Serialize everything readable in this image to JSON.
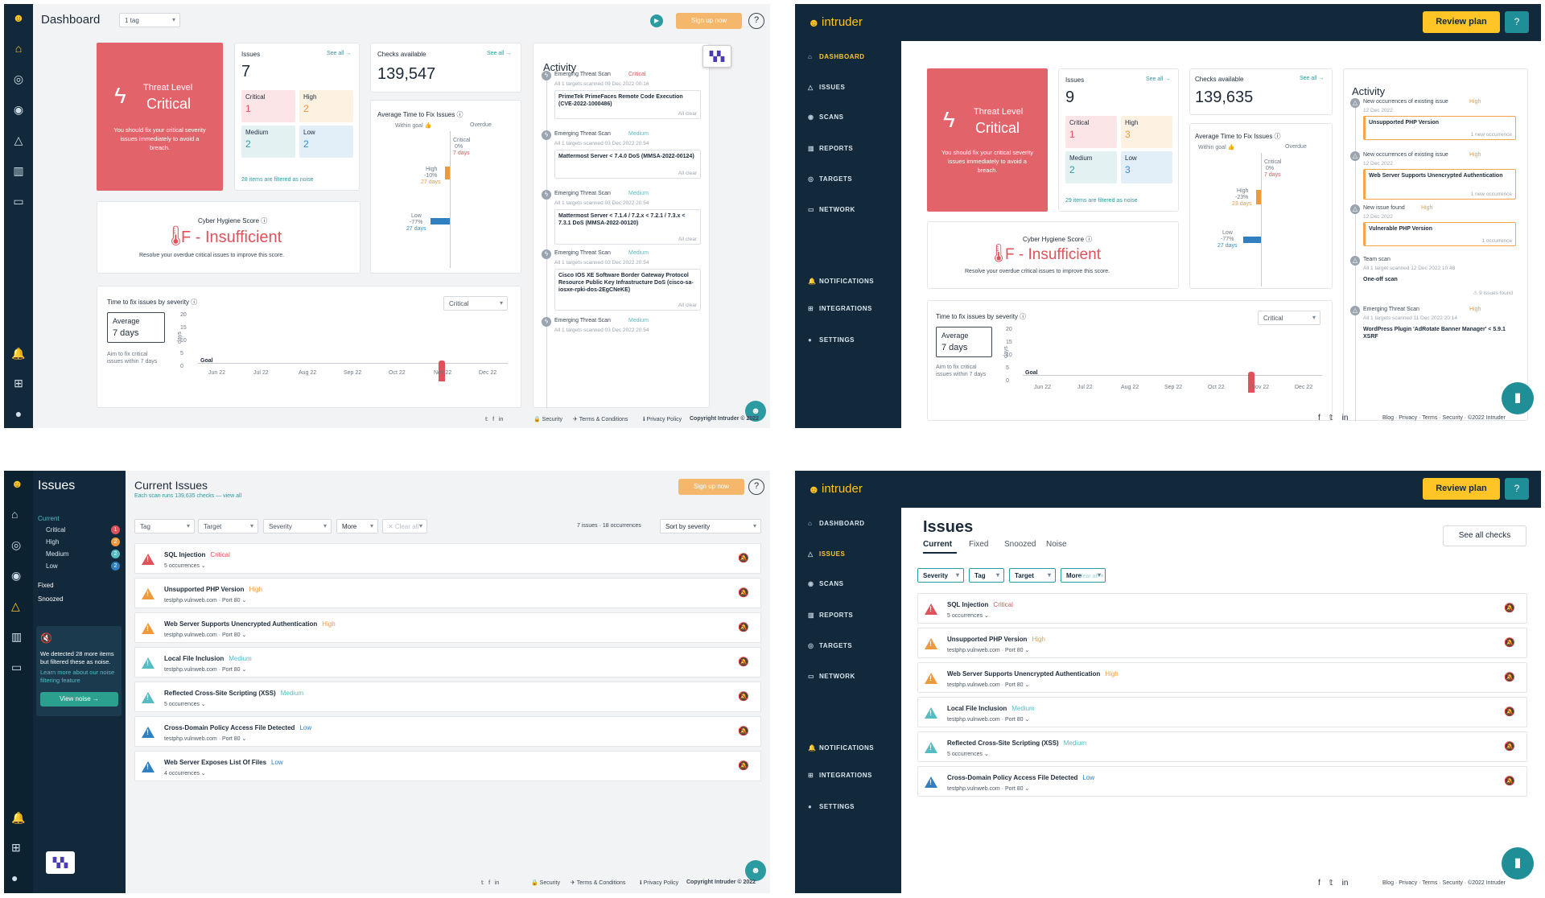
{
  "p1": {
    "title": "Dashboard",
    "tag_filter": "1 tag",
    "signup": "Sign up now",
    "help": "?",
    "threat": {
      "label": "Threat Level",
      "value": "Critical",
      "desc": "You should fix your critical severity issues immediately to avoid a breach."
    },
    "issues": {
      "title": "Issues",
      "see_all": "See all →",
      "count": "7",
      "critical": "1",
      "high": "2",
      "medium": "2",
      "low": "2",
      "note": "28 items are filtered as noise"
    },
    "checks": {
      "title": "Checks available",
      "see_all": "See all →",
      "count": "139,547"
    },
    "avg": {
      "title": "Average Time to Fix Issues ⓘ",
      "within": "Within goal 👍",
      "overdue": "Overdue",
      "crit_lbl": "Critical",
      "crit_pct": "0%",
      "crit_days": "7 days",
      "high_lbl": "High",
      "high_pct": "-10%",
      "high_days": "27 days",
      "low_lbl": "Low",
      "low_pct": "-77%",
      "low_days": "27 days"
    },
    "hygiene": {
      "title": "Cyber Hygiene Score ⓘ",
      "grade": "F - Insufficient",
      "desc": "Resolve your overdue critical issues to improve this score."
    },
    "ttf": {
      "title": "Time to fix issues by severity ⓘ",
      "select": "Critical",
      "avg_lbl": "Average",
      "avg_val": "7 days",
      "aim": "Aim to fix critical issues within 7 days",
      "goal": "Goal",
      "yaxis": "days",
      "yticks": [
        "20",
        "15",
        "10",
        "5",
        "0"
      ],
      "xticks": [
        "Jun 22",
        "Jul 22",
        "Aug 22",
        "Sep 22",
        "Oct 22",
        "Nov 22",
        "Dec 22"
      ]
    },
    "activity": {
      "title": "Activity",
      "items": [
        {
          "head": "Emerging Threat Scan",
          "sev": "Critical",
          "sub": "All 1 targets scanned 09 Dec 2022 00:16",
          "box": "PrimeTek PrimeFaces Remote Code Execution (CVE-2022-1000486)",
          "status": "All clear"
        },
        {
          "head": "Emerging Threat Scan",
          "sev": "Medium",
          "sub": "All 1 targets scanned 03 Dec 2022 20:54",
          "box": "Mattermost Server < 7.4.0 DoS (MMSA-2022-00124)",
          "status": "All clear"
        },
        {
          "head": "Emerging Threat Scan",
          "sev": "Medium",
          "sub": "All 1 targets scanned 03 Dec 2022 20:54",
          "box": "Mattermost Server < 7.1.4 / 7.2.x < 7.2.1 / 7.3.x < 7.3.1 DoS (MMSA-2022-00120)",
          "status": "All clear"
        },
        {
          "head": "Emerging Threat Scan",
          "sev": "Medium",
          "sub": "All 1 targets scanned 03 Dec 2022 20:54",
          "box": "Cisco IOS XE Software Border Gateway Protocol Resource Public Key Infrastructure DoS (cisco-sa-iosxe-rpki-dos-2EgCNeKE)",
          "status": "All clear"
        },
        {
          "head": "Emerging Threat Scan",
          "sev": "Medium",
          "sub": "All 1 targets scanned 03 Dec 2022 20:54"
        }
      ]
    },
    "footer": {
      "security": "Security",
      "terms": "Terms & Conditions",
      "privacy": "Privacy Policy",
      "copyright": "Copyright Intruder © 2022"
    }
  },
  "p2": {
    "brand": "intruder",
    "review": "Review plan",
    "help": "?",
    "nav": [
      "DASHBOARD",
      "ISSUES",
      "SCANS",
      "REPORTS",
      "TARGETS",
      "NETWORK",
      "NOTIFICATIONS",
      "INTEGRATIONS",
      "SETTINGS"
    ],
    "threat": {
      "label": "Threat Level",
      "value": "Critical",
      "desc": "You should fix your critical severity issues immediately to avoid a breach."
    },
    "issues": {
      "title": "Issues",
      "see_all": "See all →",
      "count": "9",
      "critical": "1",
      "high": "3",
      "medium": "2",
      "low": "3",
      "note": "29 items are filtered as noise"
    },
    "checks": {
      "title": "Checks available",
      "see_all": "See all →",
      "count": "139,635"
    },
    "avg": {
      "title": "Average Time to Fix Issues ⓘ",
      "within": "Within goal 👍",
      "overdue": "Overdue",
      "crit_lbl": "Critical",
      "crit_pct": "0%",
      "crit_days": "7 days",
      "high_lbl": "High",
      "high_pct": "-23%",
      "high_days": "23 days",
      "low_lbl": "Low",
      "low_pct": "-77%",
      "low_days": "27 days"
    },
    "hygiene": {
      "title": "Cyber Hygiene Score ⓘ",
      "grade": "F - Insufficient",
      "desc": "Resolve your overdue critical issues to improve this score."
    },
    "ttf": {
      "title": "Time to fix issues by severity ⓘ",
      "select": "Critical",
      "avg_lbl": "Average",
      "avg_val": "7 days",
      "aim": "Aim to fix critical issues within 7 days",
      "goal": "Goal",
      "yaxis": "days",
      "yticks": [
        "20",
        "15",
        "10",
        "5",
        "0"
      ],
      "xticks": [
        "Jun 22",
        "Jul 22",
        "Aug 22",
        "Sep 22",
        "Oct 22",
        "Nov 22",
        "Dec 22"
      ]
    },
    "activity": {
      "title": "Activity",
      "items": [
        {
          "head": "New occurrences of existing issue",
          "sev": "High",
          "sub": "12 Dec 2022",
          "box": "Unsupported PHP Version",
          "occ": "1 new occurrence"
        },
        {
          "head": "New occurrences of existing issue",
          "sev": "High",
          "sub": "12 Dec 2022",
          "box": "Web Server Supports Unencrypted Authentication",
          "occ": "1 new occurrence"
        },
        {
          "head": "New issue found",
          "sev": "High",
          "sub": "12 Dec 2022",
          "box": "Vulnerable PHP Version",
          "occ": "1 occurrence"
        },
        {
          "head": "Team scan",
          "sev": "",
          "sub": "All 1 target scanned 12 Dec 2022 10:48",
          "box": "One-off scan",
          "occ": "⚠ 9 issues found"
        },
        {
          "head": "Emerging Threat Scan",
          "sev": "High",
          "sub": "All 1 targets scanned 11 Dec 2022 20:14",
          "box": "WordPress Plugin 'AdRotate Banner Manager' < 5.9.1 XSRF"
        }
      ]
    },
    "footer": {
      "links": "Blog · Privacy · Terms · Security · ©2022 Intruder"
    }
  },
  "p3": {
    "section": "Issues",
    "side": {
      "current": "Current",
      "critical": "Critical",
      "high": "High",
      "medium": "Medium",
      "low": "Low",
      "c_crit": "1",
      "c_high": "2",
      "c_med": "2",
      "c_low": "2",
      "fixed": "Fixed",
      "snoozed": "Snoozed",
      "noise_text": "We detected 28 more items but filtered these as noise.",
      "noise_link": "Learn more about our noise filtering feature",
      "view_noise": "View noise →"
    },
    "title": "Current Issues",
    "subtitle": "Each scan runs 139,635 checks — view all",
    "signup": "Sign up now",
    "filters": {
      "tag": "Tag",
      "target": "Target",
      "severity": "Severity",
      "more": "More",
      "clear": "✕ Clear all",
      "summary": "7 issues · 18 occurrences",
      "sort": "Sort by severity"
    },
    "rows": [
      {
        "name": "SQL Injection",
        "sev": "Critical",
        "sub": "5 occurrences ⌄",
        "color": "#e0525b"
      },
      {
        "name": "Unsupported PHP Version",
        "sev": "High",
        "sub": "testphp.vulnweb.com · Port 80 ⌄",
        "color": "#ef9a3a"
      },
      {
        "name": "Web Server Supports Unencrypted Authentication",
        "sev": "High",
        "sub": "testphp.vulnweb.com · Port 80 ⌄",
        "color": "#ef9a3a"
      },
      {
        "name": "Local File Inclusion",
        "sev": "Medium",
        "sub": "testphp.vulnweb.com · Port 80 ⌄",
        "color": "#56bcc4"
      },
      {
        "name": "Reflected Cross-Site Scripting (XSS)",
        "sev": "Medium",
        "sub": "5 occurrences ⌄",
        "color": "#56bcc4"
      },
      {
        "name": "Cross-Domain Policy Access File Detected",
        "sev": "Low",
        "sub": "testphp.vulnweb.com · Port 80 ⌄",
        "color": "#2f7fc1"
      },
      {
        "name": "Web Server Exposes List Of Files",
        "sev": "Low",
        "sub": "4 occurrences ⌄",
        "color": "#2f7fc1"
      }
    ],
    "footer": {
      "security": "Security",
      "terms": "Terms & Conditions",
      "privacy": "Privacy Policy",
      "copyright": "Copyright Intruder © 2022"
    }
  },
  "p4": {
    "brand": "intruder",
    "review": "Review plan",
    "help": "?",
    "nav": [
      "DASHBOARD",
      "ISSUES",
      "SCANS",
      "REPORTS",
      "TARGETS",
      "NETWORK",
      "NOTIFICATIONS",
      "INTEGRATIONS",
      "SETTINGS"
    ],
    "title": "Issues",
    "tabs": [
      "Current",
      "Fixed",
      "Snoozed",
      "Noise"
    ],
    "see_all": "See all checks",
    "filters": {
      "severity": "Severity",
      "tag": "Tag",
      "target": "Target",
      "more": "More",
      "clear": "Clear all ✕"
    },
    "rows": [
      {
        "name": "SQL Injection",
        "sev": "Critical",
        "sub": "5 occurrences ⌄",
        "color": "#e0525b"
      },
      {
        "name": "Unsupported PHP Version",
        "sev": "High",
        "sub": "testphp.vulnweb.com · Port 80 ⌄",
        "color": "#ef9a3a"
      },
      {
        "name": "Web Server Supports Unencrypted Authentication",
        "sev": "High",
        "sub": "testphp.vulnweb.com · Port 80 ⌄",
        "color": "#ef9a3a"
      },
      {
        "name": "Local File Inclusion",
        "sev": "Medium",
        "sub": "testphp.vulnweb.com · Port 80 ⌄",
        "color": "#56bcc4"
      },
      {
        "name": "Reflected Cross-Site Scripting (XSS)",
        "sev": "Medium",
        "sub": "5 occurrences ⌄",
        "color": "#56bcc4"
      },
      {
        "name": "Cross-Domain Policy Access File Detected",
        "sev": "Low",
        "sub": "testphp.vulnweb.com · Port 80 ⌄",
        "color": "#2f7fc1"
      }
    ],
    "footer": {
      "links": "Blog · Privacy · Terms · Security · ©2022 Intruder"
    }
  },
  "colors": {
    "navy": "#11293a",
    "critical": "#e0525b",
    "high": "#ef9a3a",
    "medium": "#56bcc4",
    "low": "#2f7fc1",
    "accent": "#ffc526",
    "teal": "#2c9aa1"
  }
}
